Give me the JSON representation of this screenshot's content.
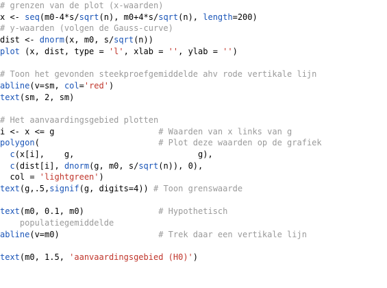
{
  "colors": {
    "comment": "#9a9a9a",
    "function": "#1a55b8",
    "string": "#c0352b",
    "text": "#000000",
    "background": "#ffffff"
  },
  "code_lines": [
    [
      {
        "t": "cm",
        "s": "# grenzen van de plot (x-waarden)"
      }
    ],
    [
      {
        "t": "pl",
        "s": "x <- "
      },
      {
        "t": "kw",
        "s": "seq"
      },
      {
        "t": "pl",
        "s": "(m0-4*s/"
      },
      {
        "t": "kw",
        "s": "sqrt"
      },
      {
        "t": "pl",
        "s": "(n), m0+4*s/"
      },
      {
        "t": "kw",
        "s": "sqrt"
      },
      {
        "t": "pl",
        "s": "(n), "
      },
      {
        "t": "kw",
        "s": "length"
      },
      {
        "t": "pl",
        "s": "=200)"
      }
    ],
    [
      {
        "t": "cm",
        "s": "# y-waarden (volgen de Gauss-curve)"
      }
    ],
    [
      {
        "t": "pl",
        "s": "dist <- "
      },
      {
        "t": "kw",
        "s": "dnorm"
      },
      {
        "t": "pl",
        "s": "(x, m0, s/"
      },
      {
        "t": "kw",
        "s": "sqrt"
      },
      {
        "t": "pl",
        "s": "(n))"
      }
    ],
    [
      {
        "t": "kw",
        "s": "plot"
      },
      {
        "t": "pl",
        "s": " (x, dist, type = "
      },
      {
        "t": "st",
        "s": "'l'"
      },
      {
        "t": "pl",
        "s": ", xlab = "
      },
      {
        "t": "st",
        "s": "''"
      },
      {
        "t": "pl",
        "s": ", ylab = "
      },
      {
        "t": "st",
        "s": "''"
      },
      {
        "t": "pl",
        "s": ")"
      }
    ],
    [],
    [
      {
        "t": "cm",
        "s": "# Toon het gevonden steekproefgemiddelde ahv rode vertikale lijn"
      }
    ],
    [
      {
        "t": "kw",
        "s": "abline"
      },
      {
        "t": "pl",
        "s": "(v=sm, "
      },
      {
        "t": "kw",
        "s": "col"
      },
      {
        "t": "pl",
        "s": "="
      },
      {
        "t": "st",
        "s": "'red'"
      },
      {
        "t": "pl",
        "s": ")"
      }
    ],
    [
      {
        "t": "kw",
        "s": "text"
      },
      {
        "t": "pl",
        "s": "(sm, 2, sm)"
      }
    ],
    [],
    [
      {
        "t": "cm",
        "s": "# Het aanvaardingsgebied plotten"
      }
    ],
    [
      {
        "t": "pl",
        "s": "i <- x <= g                     "
      },
      {
        "t": "cm",
        "s": "# Waarden van x links van g"
      }
    ],
    [
      {
        "t": "kw",
        "s": "polygon"
      },
      {
        "t": "pl",
        "s": "(                        "
      },
      {
        "t": "cm",
        "s": "# Plot deze waarden op de grafiek"
      }
    ],
    [
      {
        "t": "pl",
        "s": "  "
      },
      {
        "t": "kw",
        "s": "c"
      },
      {
        "t": "pl",
        "s": "(x[i],    g,                         g),"
      }
    ],
    [
      {
        "t": "pl",
        "s": "  "
      },
      {
        "t": "kw",
        "s": "c"
      },
      {
        "t": "pl",
        "s": "(dist[i], "
      },
      {
        "t": "kw",
        "s": "dnorm"
      },
      {
        "t": "pl",
        "s": "(g, m0, s/"
      },
      {
        "t": "kw",
        "s": "sqrt"
      },
      {
        "t": "pl",
        "s": "(n)), 0),"
      }
    ],
    [
      {
        "t": "pl",
        "s": "  col = "
      },
      {
        "t": "st",
        "s": "'lightgreen'"
      },
      {
        "t": "pl",
        "s": ")"
      }
    ],
    [
      {
        "t": "kw",
        "s": "text"
      },
      {
        "t": "pl",
        "s": "(g,.5,"
      },
      {
        "t": "kw",
        "s": "signif"
      },
      {
        "t": "pl",
        "s": "(g, digits=4)) "
      },
      {
        "t": "cm",
        "s": "# Toon grenswaarde"
      }
    ],
    [],
    [
      {
        "t": "kw",
        "s": "text"
      },
      {
        "t": "pl",
        "s": "(m0, 0.1, m0)               "
      },
      {
        "t": "cm",
        "s": "# Hypothetisch"
      }
    ],
    [
      {
        "t": "cm",
        "s": "    populatiegemiddelde"
      }
    ],
    [
      {
        "t": "kw",
        "s": "abline"
      },
      {
        "t": "pl",
        "s": "(v=m0)                    "
      },
      {
        "t": "cm",
        "s": "# Trek daar een vertikale lijn"
      }
    ],
    [],
    [
      {
        "t": "kw",
        "s": "text"
      },
      {
        "t": "pl",
        "s": "(m0, 1.5, "
      },
      {
        "t": "st",
        "s": "'aanvaardingsgebied (H0)'"
      },
      {
        "t": "pl",
        "s": ")"
      }
    ]
  ]
}
